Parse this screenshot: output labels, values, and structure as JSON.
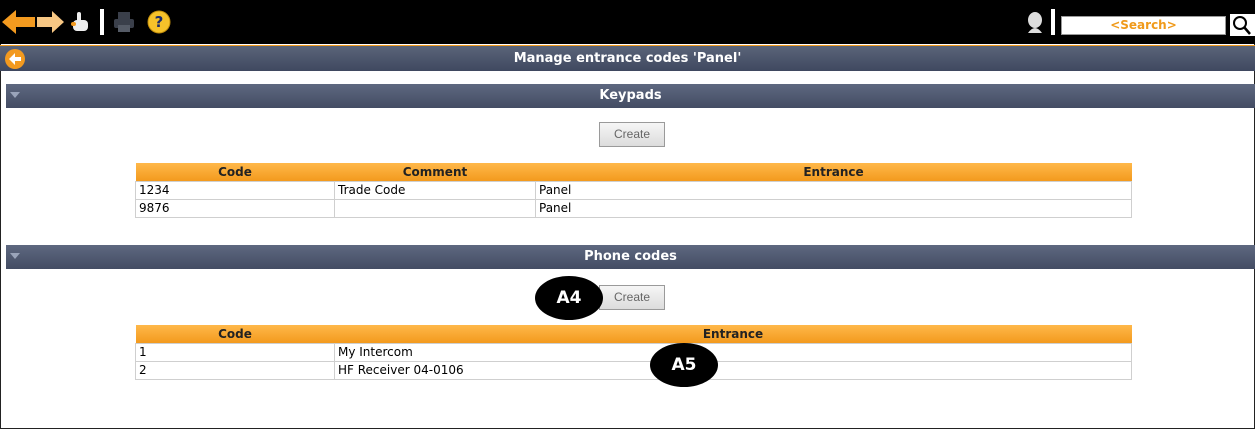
{
  "toolbar": {
    "search_placeholder": "<Search>"
  },
  "page": {
    "title": "Manage entrance codes 'Panel'"
  },
  "keypads": {
    "heading": "Keypads",
    "create_label": "Create",
    "columns": [
      "Code",
      "Comment",
      "Entrance"
    ],
    "rows": [
      {
        "code": "1234",
        "comment": "Trade Code",
        "entrance": "Panel"
      },
      {
        "code": "9876",
        "comment": "",
        "entrance": "Panel"
      }
    ]
  },
  "phone_codes": {
    "heading": "Phone codes",
    "create_label": "Create",
    "columns": [
      "Code",
      "Entrance"
    ],
    "rows": [
      {
        "code": "1",
        "entrance": "My Intercom"
      },
      {
        "code": "2",
        "entrance": "HF Receiver 04-0106"
      }
    ]
  },
  "annotations": {
    "a4": "A4",
    "a5": "A5"
  },
  "colors": {
    "accent": "#f39a1d",
    "header_bar": "#4a536a",
    "toolbar": "#000000"
  }
}
